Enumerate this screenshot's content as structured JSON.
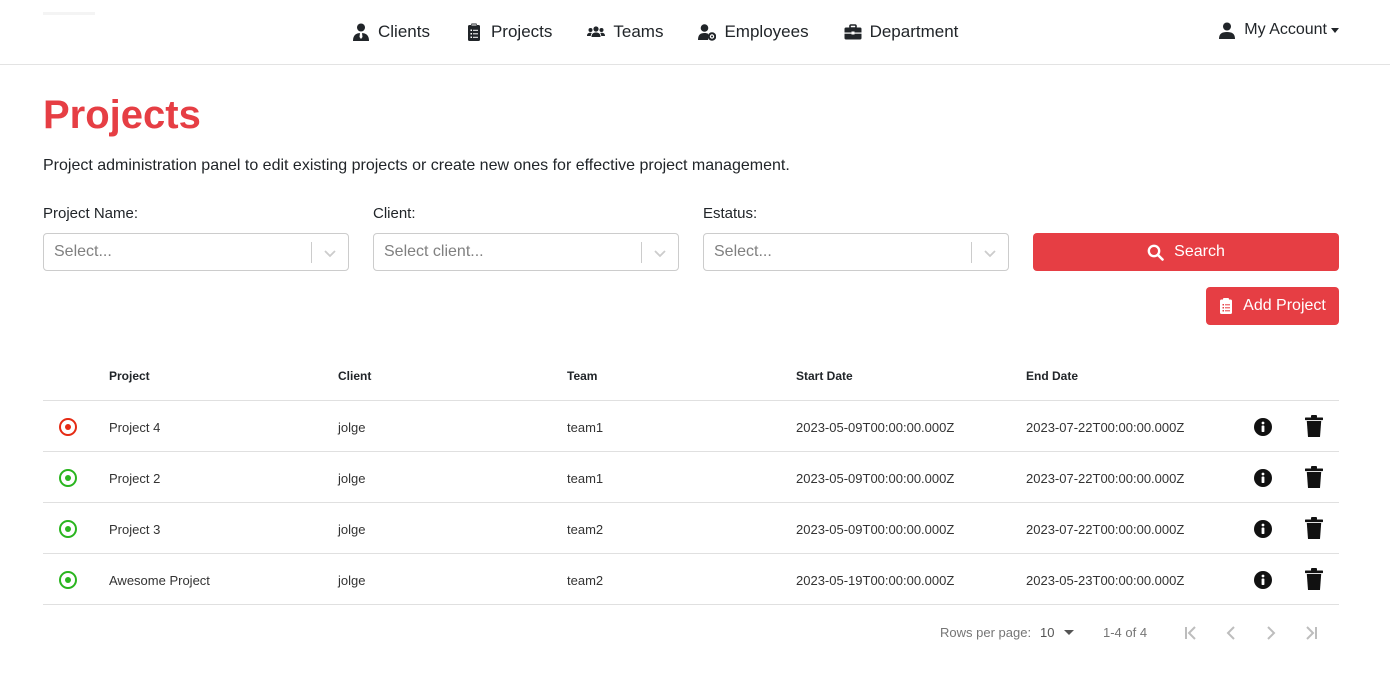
{
  "nav": {
    "items": [
      {
        "label": "Clients",
        "icon": "user-tie-icon"
      },
      {
        "label": "Projects",
        "icon": "clipboard-list-icon"
      },
      {
        "label": "Teams",
        "icon": "users-icon"
      },
      {
        "label": "Employees",
        "icon": "user-gear-icon"
      },
      {
        "label": "Department",
        "icon": "briefcase-icon"
      }
    ],
    "account_label": "My Account"
  },
  "page": {
    "title": "Projects",
    "description": "Project administration panel to edit existing projects or create new ones for effective project management."
  },
  "filters": {
    "project_label": "Project Name:",
    "project_placeholder": "Select...",
    "client_label": "Client:",
    "client_placeholder": "Select client...",
    "status_label": "Estatus:",
    "status_placeholder": "Select...",
    "search_label": "Search",
    "add_label": "Add Project"
  },
  "table": {
    "headers": [
      "Project",
      "Client",
      "Team",
      "Start Date",
      "End Date"
    ],
    "rows": [
      {
        "status": "inactive",
        "status_color": "#e52b14",
        "project": "Project 4",
        "client": "jolge",
        "team": "team1",
        "start": "2023-05-09T00:00:00.000Z",
        "end": "2023-07-22T00:00:00.000Z"
      },
      {
        "status": "active",
        "status_color": "#2ab51f",
        "project": "Project 2",
        "client": "jolge",
        "team": "team1",
        "start": "2023-05-09T00:00:00.000Z",
        "end": "2023-07-22T00:00:00.000Z"
      },
      {
        "status": "active",
        "status_color": "#2ab51f",
        "project": "Project 3",
        "client": "jolge",
        "team": "team2",
        "start": "2023-05-09T00:00:00.000Z",
        "end": "2023-07-22T00:00:00.000Z"
      },
      {
        "status": "active",
        "status_color": "#2ab51f",
        "project": "Awesome Project",
        "client": "jolge",
        "team": "team2",
        "start": "2023-05-19T00:00:00.000Z",
        "end": "2023-05-23T00:00:00.000Z"
      }
    ]
  },
  "pagination": {
    "rows_per_page_label": "Rows per page:",
    "rows_per_page": "10",
    "range": "1-4 of 4"
  },
  "colors": {
    "accent": "#e63e44"
  }
}
